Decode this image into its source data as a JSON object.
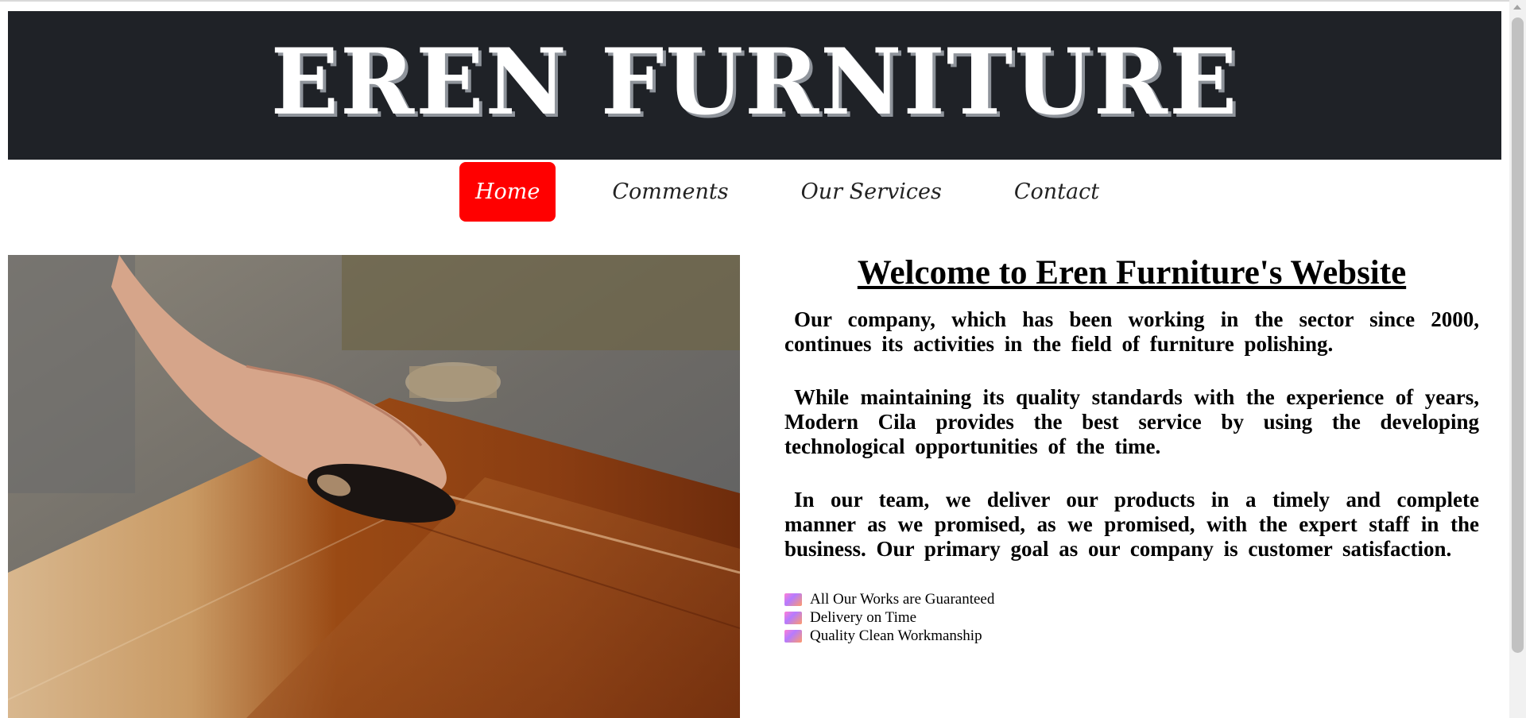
{
  "site": {
    "title": "EREN FURNITURE"
  },
  "nav": {
    "items": [
      {
        "label": "Home",
        "active": true
      },
      {
        "label": "Comments",
        "active": false
      },
      {
        "label": "Our Services",
        "active": false
      },
      {
        "label": "Contact",
        "active": false
      }
    ]
  },
  "hero": {
    "image_subject": "hand polishing wooden table"
  },
  "main": {
    "heading": "Welcome to Eren Furniture's Website",
    "paragraphs": [
      "Our company, which has been working in the sector since 2000, continues its activities in the field of furniture polishing.",
      "While maintaining its quality standards with the experience of years, Modern Cila provides the best service by using the developing technological opportunities of the time.",
      "In our team, we deliver our products in a timely and complete manner as we promised, as we promised, with the expert staff in the business. Our primary goal as our company is customer satisfaction."
    ],
    "features": [
      "All Our Works are Guaranteed",
      "Delivery on Time",
      "Quality Clean Workmanship"
    ]
  },
  "colors": {
    "header_bg": "#1f2227",
    "nav_active_bg": "#ff0000"
  }
}
